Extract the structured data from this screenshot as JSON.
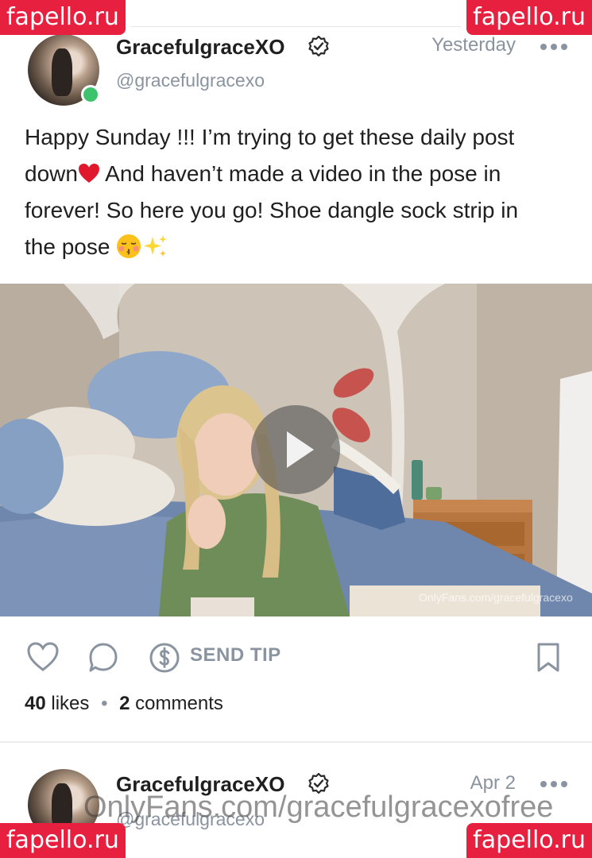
{
  "watermarks": {
    "site": "fapello.ru",
    "footer": "OnlyFans.com/gracefulgracexofree",
    "video": "OnlyFans.com/gracefulgracexo"
  },
  "posts": [
    {
      "author": {
        "display_name": "GracefulgraceXO",
        "handle": "@gracefulgracexo",
        "online": true
      },
      "timestamp": "Yesterday",
      "text": {
        "line1": "Happy Sunday !!! I’m trying to get these daily post",
        "line2a": "down",
        "line2b": " And haven’t made a video in the pose in",
        "line3": "forever! So here you go! Shoe dangle sock strip in",
        "line4": "the pose "
      },
      "actions": {
        "send_tip_label": "SEND TIP"
      },
      "stats": {
        "likes_count": "40",
        "likes_label": "likes",
        "comments_count": "2",
        "comments_label": "comments"
      }
    },
    {
      "author": {
        "display_name": "GracefulgraceXO",
        "handle": "@gracefulgracexo"
      },
      "timestamp": "Apr 2"
    }
  ],
  "icons": [
    "more-icon",
    "verified-icon",
    "heart-icon",
    "comment-icon",
    "dollar-icon",
    "bookmark-icon",
    "play-icon"
  ],
  "colors": {
    "accent": "#e8203f",
    "muted": "#8a94a0",
    "online": "#3cc36b"
  }
}
